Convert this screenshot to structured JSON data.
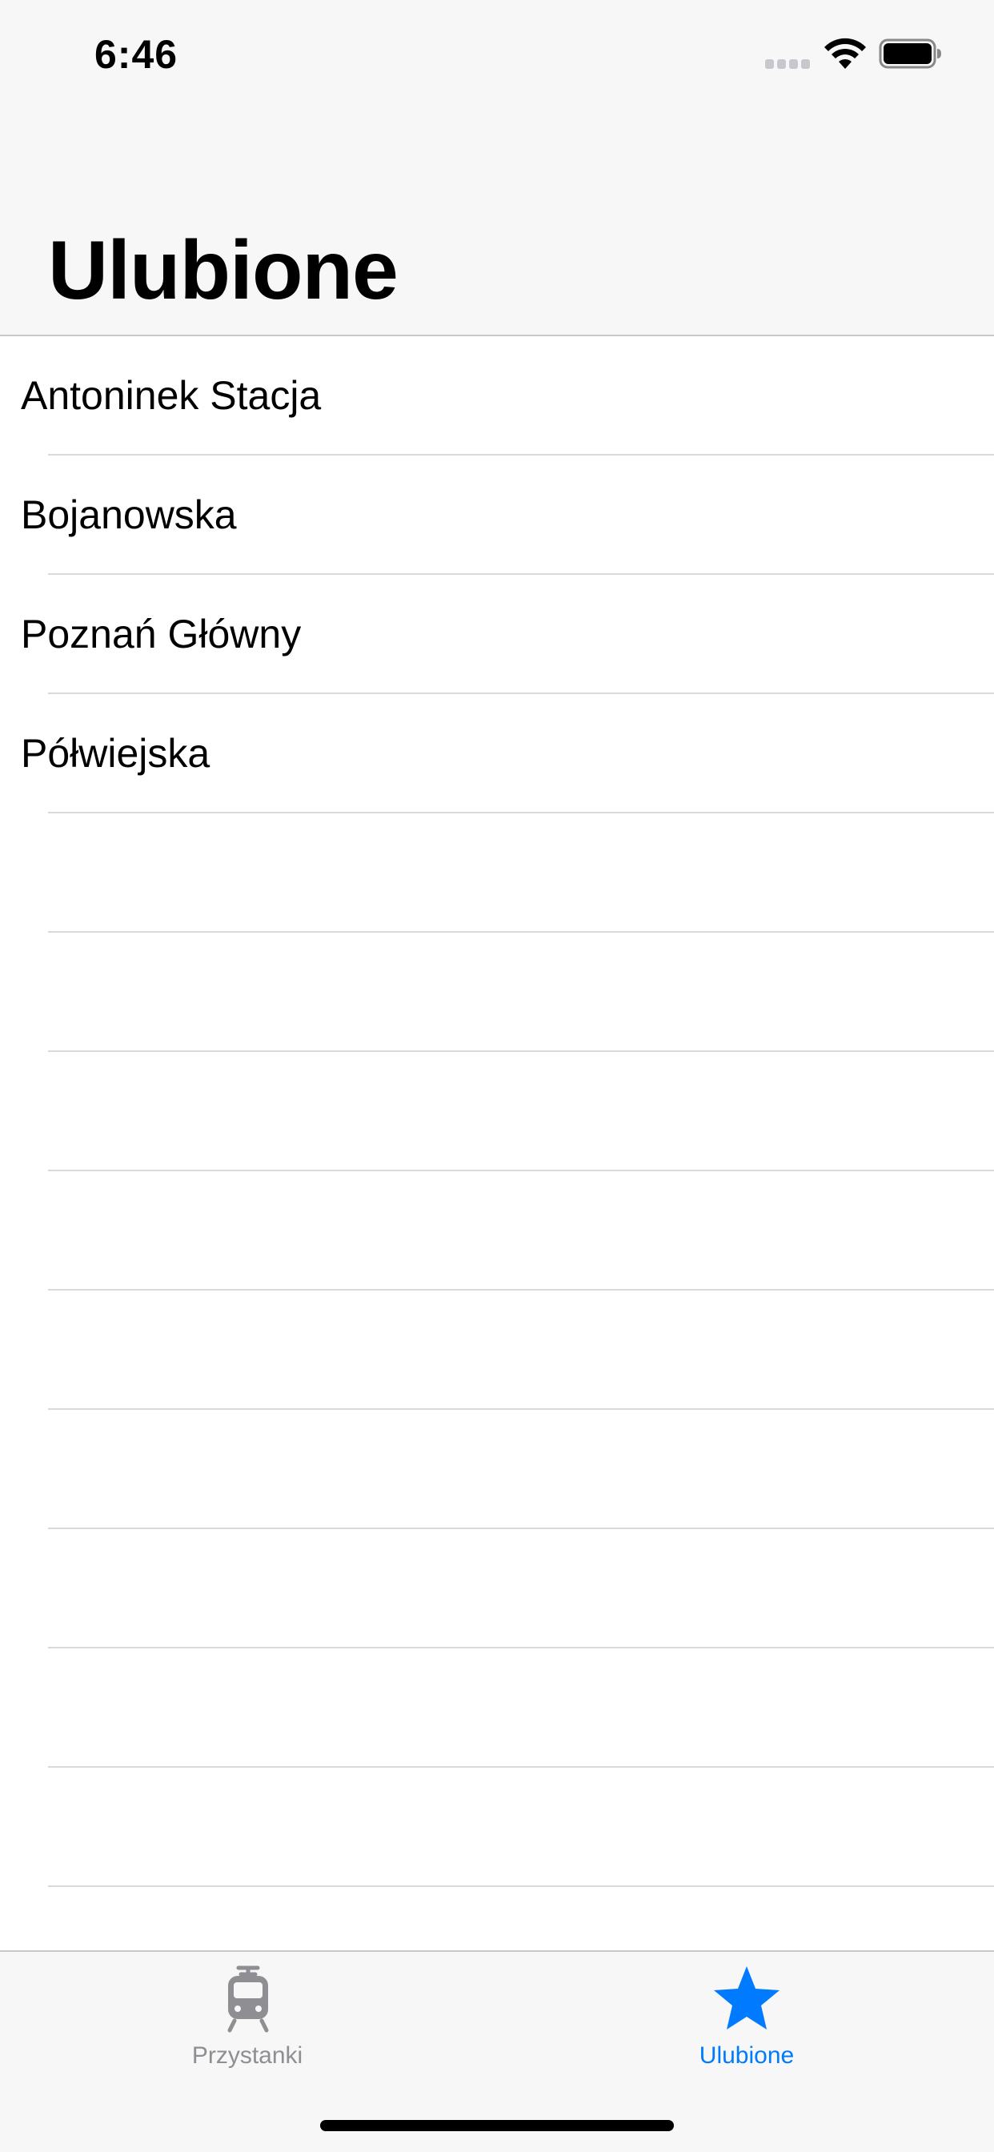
{
  "status_bar": {
    "time": "6:46"
  },
  "navigation": {
    "title": "Ulubione"
  },
  "favorites": {
    "items": [
      {
        "label": "Antoninek Stacja"
      },
      {
        "label": "Bojanowska"
      },
      {
        "label": "Poznań Główny"
      },
      {
        "label": "Półwiejska"
      }
    ]
  },
  "tab_bar": {
    "tabs": [
      {
        "label": "Przystanki",
        "icon": "tram-icon",
        "color": "#8e8e93",
        "selected": false
      },
      {
        "label": "Ulubione",
        "icon": "star-icon",
        "color": "#007aff",
        "selected": true
      }
    ]
  },
  "colors": {
    "accent": "#007aff",
    "inactive": "#8e8e93",
    "bar_background": "#f7f7f7",
    "separator": "#d9d9dd"
  }
}
